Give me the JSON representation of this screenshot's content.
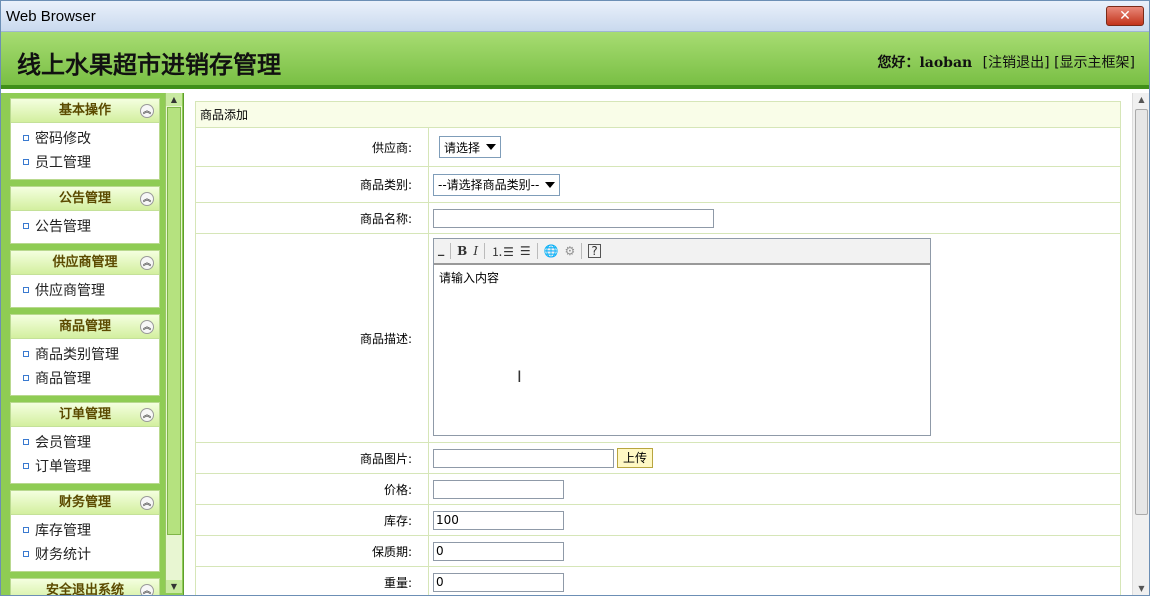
{
  "window": {
    "title": "Web Browser",
    "close_label": "✕"
  },
  "header": {
    "site_title": "线上水果超市进销存管理",
    "greeting": "您好：",
    "username": "laoban",
    "logout": "[注销退出]",
    "show_frame": "[显示主框架]"
  },
  "sidebar": {
    "groups": [
      {
        "title": "基本操作",
        "items": [
          "密码修改",
          "员工管理"
        ]
      },
      {
        "title": "公告管理",
        "items": [
          "公告管理"
        ]
      },
      {
        "title": "供应商管理",
        "items": [
          "供应商管理"
        ]
      },
      {
        "title": "商品管理",
        "items": [
          "商品类别管理",
          "商品管理"
        ]
      },
      {
        "title": "订单管理",
        "items": [
          "会员管理",
          "订单管理"
        ]
      },
      {
        "title": "财务管理",
        "items": [
          "库存管理",
          "财务统计"
        ]
      },
      {
        "title": "安全退出系统",
        "items": []
      }
    ]
  },
  "form": {
    "panel_title": "商品添加",
    "supplier": {
      "label": "供应商:",
      "value": "请选择"
    },
    "category": {
      "label": "商品类别:",
      "value": "--请选择商品类别--"
    },
    "name": {
      "label": "商品名称:",
      "value": ""
    },
    "description": {
      "label": "商品描述:",
      "placeholder": "请输入内容"
    },
    "image": {
      "label": "商品图片:",
      "value": "",
      "upload_label": "上传"
    },
    "price": {
      "label": "价格:",
      "value": ""
    },
    "stock": {
      "label": "库存:",
      "value": "100"
    },
    "shelf_life": {
      "label": "保质期:",
      "value": "0"
    },
    "weight": {
      "label": "重量:",
      "value": "0"
    }
  },
  "editor_toolbar": [
    "B",
    "I",
    "ordered-list-icon",
    "unordered-list-icon",
    "link-icon",
    "unlink-icon",
    "help-icon"
  ],
  "colors": {
    "header_green": "#79bf44",
    "sidebar_green": "#8fcc54",
    "panel_border": "#d6e6b8"
  }
}
